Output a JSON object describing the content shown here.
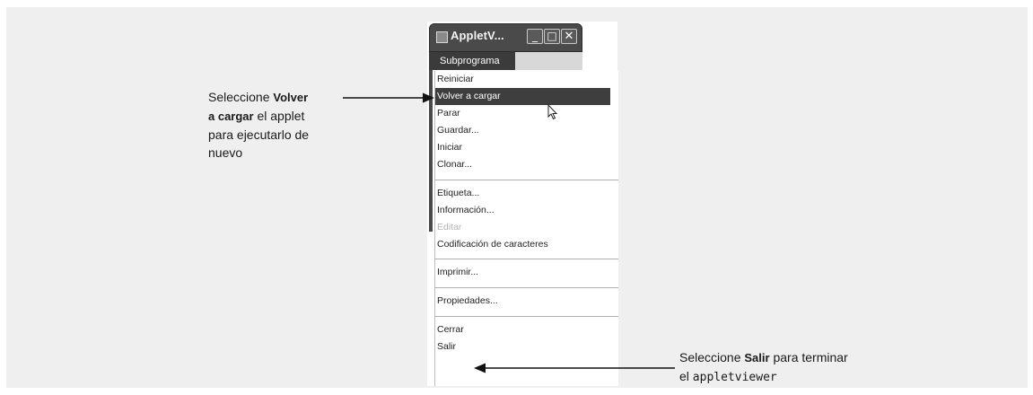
{
  "window": {
    "title": "AppletV...",
    "menu_title": "Subprograma",
    "controls": {
      "minimize": "_",
      "maximize": "□",
      "close": "✕"
    }
  },
  "menu": {
    "items": [
      {
        "label": "Reiniciar",
        "state": "normal"
      },
      {
        "label": "Volver a cargar",
        "state": "selected"
      },
      {
        "label": "Parar",
        "state": "normal"
      },
      {
        "label": "Guardar...",
        "state": "normal"
      },
      {
        "label": "Iniciar",
        "state": "normal"
      },
      {
        "label": "Clonar...",
        "state": "normal"
      },
      {
        "label": "Etiqueta...",
        "state": "normal"
      },
      {
        "label": "Información...",
        "state": "normal"
      },
      {
        "label": "Editar",
        "state": "disabled"
      },
      {
        "label": "Codificación de caracteres",
        "state": "normal"
      },
      {
        "label": "Imprimir...",
        "state": "normal"
      },
      {
        "label": "Propiedades...",
        "state": "normal"
      },
      {
        "label": "Cerrar",
        "state": "normal"
      },
      {
        "label": "Salir",
        "state": "normal"
      }
    ]
  },
  "annotations": {
    "reload": {
      "prefix": "Seleccione ",
      "bold1": "Volver",
      "bold2": "a cargar",
      "line2_rest": " el applet",
      "line3": "para ejecutarlo de",
      "line4": "nuevo"
    },
    "exit": {
      "prefix": "Seleccione ",
      "bold": "Salir",
      "rest": " para terminar",
      "line2_prefix": "el ",
      "line2_code": "appletviewer"
    }
  },
  "colors": {
    "background": "#efefef",
    "titlebar": "#4a4a4a",
    "selected": "#3e3e3e",
    "disabled_text": "#b4b4b4"
  }
}
